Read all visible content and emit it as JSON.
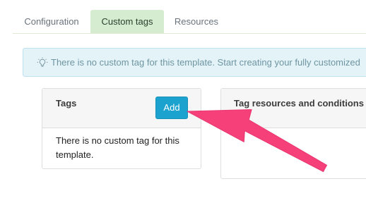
{
  "tabs": [
    {
      "label": "Configuration"
    },
    {
      "label": "Custom tags"
    },
    {
      "label": "Resources"
    }
  ],
  "alert": {
    "icon": "lightbulb-icon",
    "message": "There is no custom tag for this template. Start creating your fully customized"
  },
  "tags_panel": {
    "title": "Tags",
    "add_label": "Add",
    "empty_message": "There is no custom tag for this template."
  },
  "resources_panel": {
    "title": "Tag resources and conditions"
  },
  "annotation": {
    "icon": "pointer-arrow-icon",
    "color": "#f5407a"
  }
}
